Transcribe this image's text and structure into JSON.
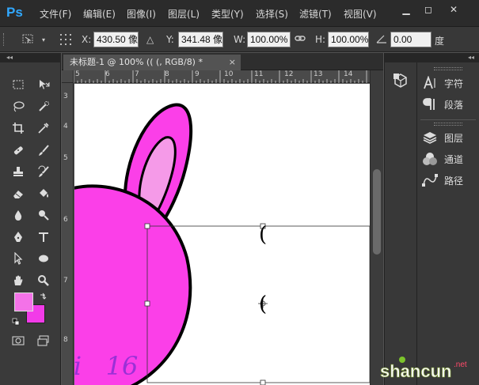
{
  "app": {
    "logo": "Ps",
    "menu": [
      "文件(F)",
      "编辑(E)",
      "图像(I)",
      "图层(L)",
      "类型(Y)",
      "选择(S)",
      "滤镜(T)",
      "视图(V)"
    ],
    "window_controls": {
      "minimize": "▁",
      "restore": "◻",
      "close": "✕"
    }
  },
  "options": {
    "x_label": "X:",
    "x_value": "430.50 像",
    "y_label": "Y:",
    "y_value": "341.48 像",
    "w_label": "W:",
    "w_value": "100.00%",
    "h_label": "H:",
    "h_value": "100.00%",
    "angle_value": "0.00",
    "angle_unit": "度"
  },
  "document": {
    "tab_title": "未标题-1 @ 100% ((        (, RGB/8) *",
    "tab_close": "×",
    "ruler_top_labels": [
      "5",
      "6",
      "7",
      "8",
      "9",
      "10",
      "11",
      "12",
      "13",
      "14"
    ],
    "ruler_left_labels": [
      "3",
      "4",
      "5",
      "6",
      "7",
      "8"
    ],
    "canvas_text": "ti   16",
    "chars": [
      "(",
      "("
    ]
  },
  "panels": {
    "collapse": "◂◂",
    "items": [
      {
        "icon": "character-icon",
        "label": "字符"
      },
      {
        "icon": "paragraph-icon",
        "label": "段落"
      },
      {
        "icon": "layers-icon",
        "label": "图层"
      },
      {
        "icon": "channels-icon",
        "label": "通道"
      },
      {
        "icon": "paths-icon",
        "label": "路径"
      }
    ]
  },
  "colors": {
    "foreground": "#f472e8",
    "background": "#f23be8",
    "bunny_fill": "#fb3fe8",
    "ear_inner": "#f59ae8"
  },
  "watermark": {
    "text": "shancun",
    "sub": ".net"
  }
}
